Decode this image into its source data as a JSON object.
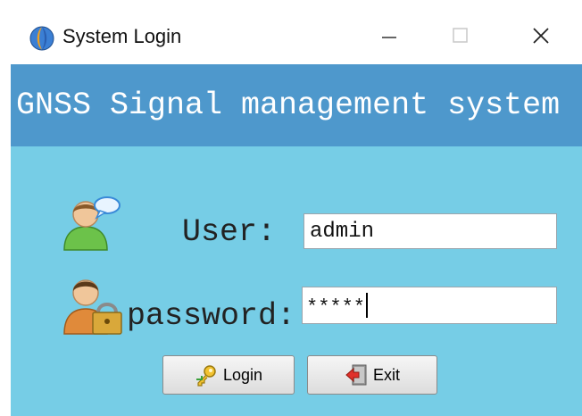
{
  "window": {
    "title": "System Login",
    "minimize_icon": "minimize-icon",
    "maximize_icon": "maximize-icon",
    "close_icon": "close-icon"
  },
  "banner": {
    "text": "GNSS Signal management system"
  },
  "form": {
    "user_label": "User:",
    "user_value": "admin",
    "password_label": "password:",
    "password_value": "*****",
    "user_icon": "user-chat-icon",
    "password_icon": "user-lock-icon"
  },
  "buttons": {
    "login_label": "Login",
    "login_icon": "key-icon",
    "exit_label": "Exit",
    "exit_icon": "exit-door-icon"
  },
  "colors": {
    "banner": "#4e98cc",
    "background": "#76cde6",
    "titlebar": "#ffffff"
  }
}
